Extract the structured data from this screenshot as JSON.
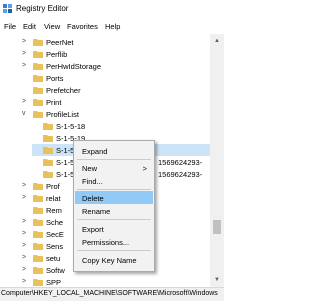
{
  "window": {
    "title": "Registry Editor"
  },
  "menu": [
    "File",
    "Edit",
    "View",
    "Favorites",
    "Help"
  ],
  "tree": {
    "items": [
      {
        "label": "PeerNet",
        "expander": ">"
      },
      {
        "label": "Perflib",
        "expander": ">"
      },
      {
        "label": "PerHwIdStorage",
        "expander": ">"
      },
      {
        "label": "Ports",
        "expander": ""
      },
      {
        "label": "Prefetcher",
        "expander": ""
      },
      {
        "label": "Print",
        "expander": ">"
      },
      {
        "label": "ProfileList",
        "expander": "v"
      },
      {
        "label": "S-1-5-18",
        "expander": ""
      },
      {
        "label": "S-1-5-19",
        "expander": ""
      },
      {
        "label": "S-1-5-20",
        "expander": ""
      },
      {
        "label": "S-1-5-21-",
        "expander": ""
      },
      {
        "label": "S-1-5-21-",
        "expander": ""
      },
      {
        "label": "Prof",
        "expander": ">"
      },
      {
        "label": "relat",
        "expander": ">"
      },
      {
        "label": "Rem",
        "expander": ""
      },
      {
        "label": "Sche",
        "expander": ">"
      },
      {
        "label": "SecE",
        "expander": ">"
      },
      {
        "label": "Sens",
        "expander": ">"
      },
      {
        "label": "setu",
        "expander": ">"
      },
      {
        "label": "Softw",
        "expander": ">"
      },
      {
        "label": "SPP",
        "expander": ">"
      }
    ],
    "sid_suffix_1": "1569624293-",
    "sid_suffix_2": "1569624293-"
  },
  "context_menu": {
    "expand": "Expand",
    "new": "New",
    "new_arrow": ">",
    "find": "Find...",
    "delete": "Delete",
    "rename": "Rename",
    "export": "Export",
    "permissions": "Permissions...",
    "copy_key_name": "Copy Key Name"
  },
  "status_bar": "Computer\\HKEY_LOCAL_MACHINE\\SOFTWARE\\Microsoft\\Windows",
  "colors": {
    "folder": "#e8c15b",
    "selection": "#cce4f7",
    "highlight": "#91c9f7"
  },
  "scroll": {
    "up": "▲",
    "down": "▼"
  }
}
